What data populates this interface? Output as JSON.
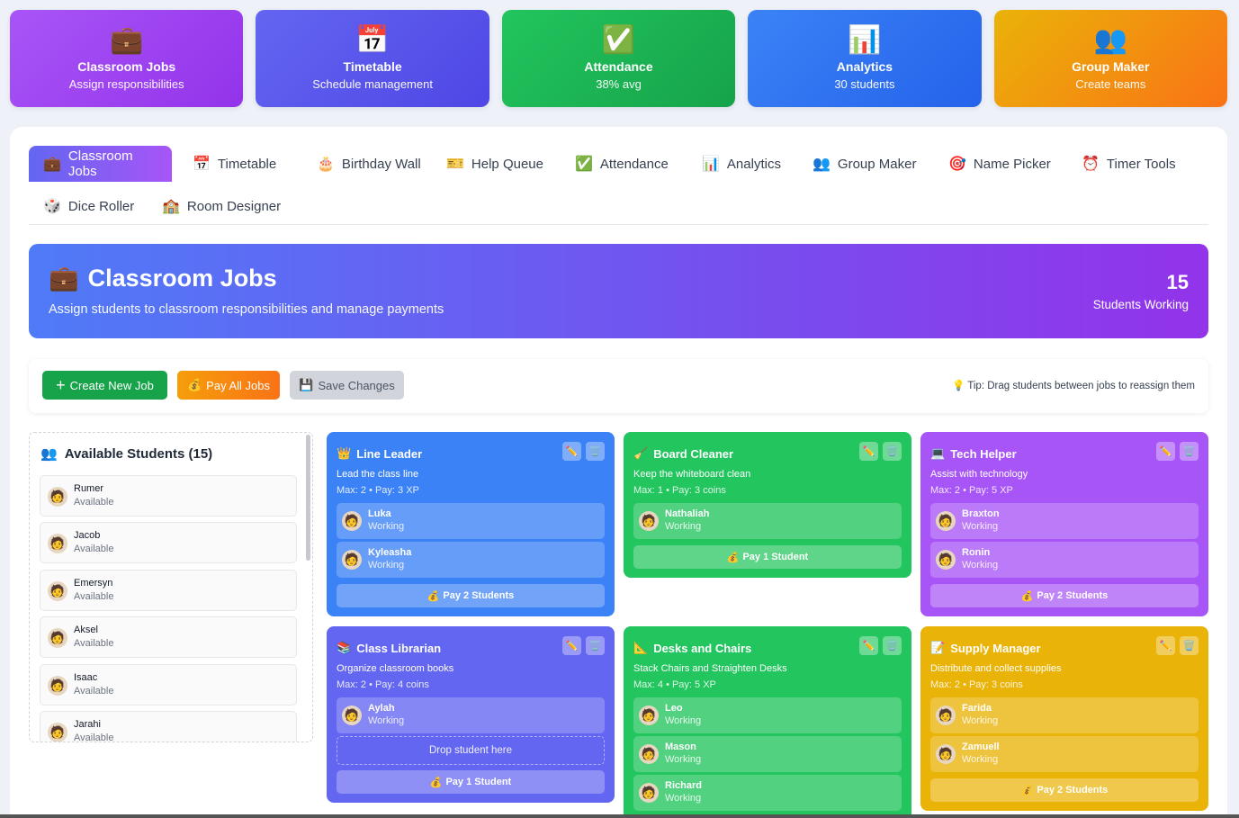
{
  "stats": [
    {
      "icon": "💼",
      "title": "Classroom Jobs",
      "sub": "Assign responsibilities"
    },
    {
      "icon": "📅",
      "title": "Timetable",
      "sub": "Schedule management"
    },
    {
      "icon": "✅",
      "title": "Attendance",
      "sub": "38% avg"
    },
    {
      "icon": "📊",
      "title": "Analytics",
      "sub": "30 students"
    },
    {
      "icon": "👥",
      "title": "Group Maker",
      "sub": "Create teams"
    }
  ],
  "tabs": [
    {
      "icon": "💼",
      "label": "Classroom Jobs"
    },
    {
      "icon": "📅",
      "label": "Timetable"
    },
    {
      "icon": "🎂",
      "label": "Birthday Wall"
    },
    {
      "icon": "🎫",
      "label": "Help Queue"
    },
    {
      "icon": "✅",
      "label": "Attendance"
    },
    {
      "icon": "📊",
      "label": "Analytics"
    },
    {
      "icon": "👥",
      "label": "Group Maker"
    },
    {
      "icon": "🎯",
      "label": "Name Picker"
    },
    {
      "icon": "⏰",
      "label": "Timer Tools"
    },
    {
      "icon": "🎲",
      "label": "Dice Roller"
    },
    {
      "icon": "🏫",
      "label": "Room Designer"
    }
  ],
  "hero": {
    "icon": "💼",
    "title": "Classroom Jobs",
    "subtitle": "Assign students to classroom responsibilities and manage payments",
    "count": "15",
    "count_label": "Students Working"
  },
  "toolbar": {
    "create_label": "Create New Job",
    "pay_label": "Pay All Jobs",
    "save_label": "Save Changes",
    "tip": "Tip: Drag students between jobs to reassign them"
  },
  "sidebar": {
    "title": "Available Students (15)",
    "students": [
      {
        "name": "Rumer",
        "status": "Available"
      },
      {
        "name": "Jacob",
        "status": "Available"
      },
      {
        "name": "Emersyn",
        "status": "Available"
      },
      {
        "name": "Aksel",
        "status": "Available"
      },
      {
        "name": "Isaac",
        "status": "Available"
      },
      {
        "name": "Jarahi",
        "status": "Available"
      }
    ]
  },
  "jobs": [
    {
      "icon": "👑",
      "title": "Line Leader",
      "desc": "Lead the class line",
      "meta": "Max: 2 • Pay: 3 XP",
      "color": "#3b82f6",
      "workers": [
        {
          "name": "Luka",
          "status": "Working"
        },
        {
          "name": "Kyleasha",
          "status": "Working"
        }
      ],
      "pay": "Pay 2 Students"
    },
    {
      "icon": "🧹",
      "title": "Board Cleaner",
      "desc": "Keep the whiteboard clean",
      "meta": "Max: 1 • Pay: 3 coins",
      "color": "#22c55e",
      "workers": [
        {
          "name": "Nathaliah",
          "status": "Working"
        }
      ],
      "pay": "Pay 1 Student"
    },
    {
      "icon": "💻",
      "title": "Tech Helper",
      "desc": "Assist with technology",
      "meta": "Max: 2 • Pay: 5 XP",
      "color": "#a855f7",
      "workers": [
        {
          "name": "Braxton",
          "status": "Working"
        },
        {
          "name": "Ronin",
          "status": "Working"
        }
      ],
      "pay": "Pay 2 Students"
    },
    {
      "icon": "📚",
      "title": "Class Librarian",
      "desc": "Organize classroom books",
      "meta": "Max: 2 • Pay: 4 coins",
      "color": "#6366f1",
      "workers": [
        {
          "name": "Aylah",
          "status": "Working"
        }
      ],
      "drop": "Drop student here",
      "pay": "Pay 1 Student"
    },
    {
      "icon": "📐",
      "title": "Desks and Chairs",
      "desc": "Stack Chairs and Straighten Desks",
      "meta": "Max: 4 • Pay: 5 XP",
      "color": "#22c55e",
      "workers": [
        {
          "name": "Leo",
          "status": "Working"
        },
        {
          "name": "Mason",
          "status": "Working"
        },
        {
          "name": "Richard",
          "status": "Working"
        }
      ]
    },
    {
      "icon": "📝",
      "title": "Supply Manager",
      "desc": "Distribute and collect supplies",
      "meta": "Max: 2 • Pay: 3 coins",
      "color": "#eab308",
      "workers": [
        {
          "name": "Farida",
          "status": "Working"
        },
        {
          "name": "Zamuell",
          "status": "Working"
        }
      ],
      "pay": "Pay 2 Students"
    }
  ]
}
